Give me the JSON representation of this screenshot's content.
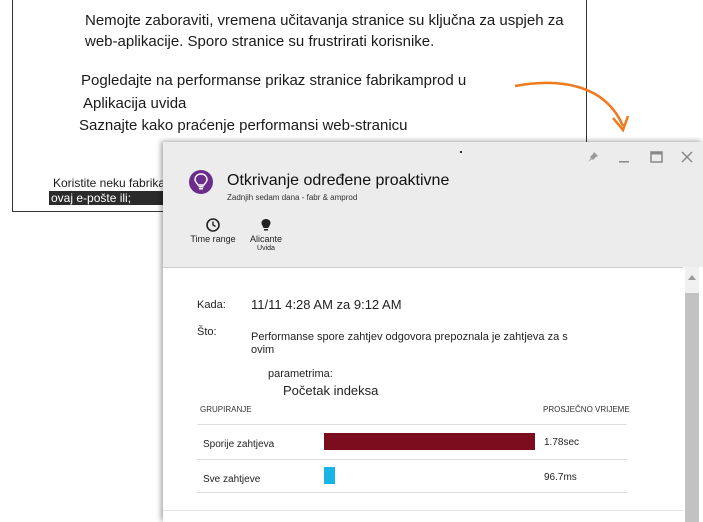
{
  "email": {
    "para1": "Nemojte zaboraviti, vremena učitavanja stranice su ključna za uspjeh za web-aplikacije. Sporo stranice su frustrirati korisnike.",
    "para2": "Pogledajte na performanse prikaz stranice fabrikamprod u",
    "line_aplikacija": "Aplikacija uvida",
    "line_saznajte": "Saznajte kako praćenje performansi web-stranicu",
    "footer1": "Koristite neku fabrikamprod",
    "footer2": "ovaj e-pošte ili;"
  },
  "colors": {
    "arrow": "#f07a1d",
    "bar_slow": "#7b0d1e",
    "bar_all": "#1ab3e6",
    "icon_bg": "#6b2c8c"
  },
  "blade": {
    "title": "Otkrivanje određene proaktivne",
    "subtitle": "Zadnjih sedam dana - fabr & amprod",
    "controls": {
      "pin": "pin-icon",
      "minimize": "minimize-icon",
      "maximize": "maximize-icon",
      "close": "close-icon"
    },
    "toolbar": {
      "time_range": "Time range",
      "alerts_line1": "Alicante",
      "alerts_line2": "Uvida"
    },
    "details": {
      "kada_label": "Kada:",
      "kada_value": "11/11 4:28 AM za 9:12 AM",
      "sto_label": "Što:",
      "sto_value": "Performanse spore zahtjev odgovora prepoznala je zahtjeva za s ovim",
      "param_label": "parametrima:",
      "param_value": "Početak indeksa"
    },
    "table": {
      "col_group": "GRUPIRANJE",
      "col_avg": "PROSJEČNO VRIJEME",
      "rows": [
        {
          "label": "Sporije zahtjeva",
          "value": "1.78sec",
          "value_ms": 1780
        },
        {
          "label": "Sve zahtjeve",
          "value": "96.7ms",
          "value_ms": 96.7
        }
      ]
    }
  }
}
